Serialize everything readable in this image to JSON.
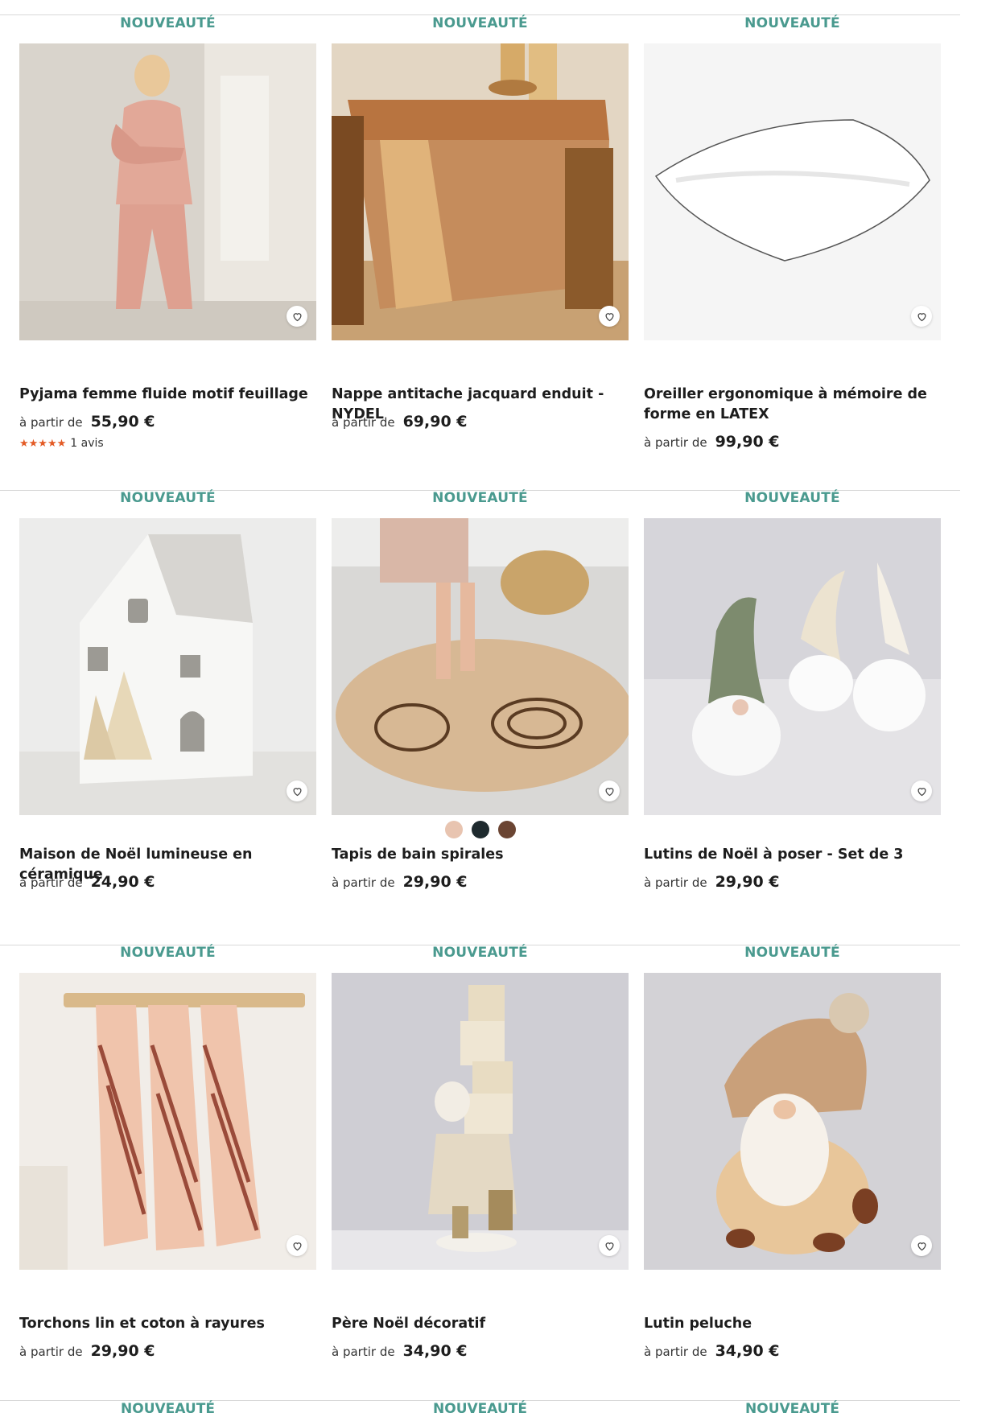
{
  "badge_label": "NOUVEAUTÉ",
  "price_prefix": "à partir de",
  "colors": {
    "badge": "#4a9a8f",
    "stars": "#e35b26",
    "separator": "#d9d9d9"
  },
  "products": [
    {
      "title": "Pyjama femme fluide motif feuillage",
      "price": "55,90 €",
      "rating_stars": 5,
      "reviews": "1 avis",
      "image": "pink-pyjama-woman-photo"
    },
    {
      "title": "Nappe antitache jacquard enduit - NYDEL",
      "price": "69,90 €",
      "image": "brown-jacquard-tablecloth-photo"
    },
    {
      "title": "Oreiller ergonomique à mémoire de forme en LATEX",
      "price": "99,90 €",
      "image": "white-pillow-photo"
    },
    {
      "title": "Maison de Noël lumineuse en céramique",
      "price": "24,90 €",
      "image": "ceramic-christmas-house-photo"
    },
    {
      "title": "Tapis de bain spirales",
      "price": "29,90 €",
      "image": "round-spiral-bath-mat-photo",
      "color_options": [
        "#e8c4b0",
        "#1e2a2e",
        "#6b4533"
      ]
    },
    {
      "title": "Lutins de Noël à poser - Set de 3",
      "price": "29,90 €",
      "image": "three-christmas-gnomes-photo"
    },
    {
      "title": "Torchons lin et coton à rayures",
      "price": "29,90 €",
      "image": "striped-tea-towels-photo"
    },
    {
      "title": "Père Noël décoratif",
      "price": "34,90 €",
      "image": "decorative-santa-figure-photo"
    },
    {
      "title": "Lutin peluche",
      "price": "34,90 €",
      "image": "plush-gnome-photo"
    }
  ]
}
